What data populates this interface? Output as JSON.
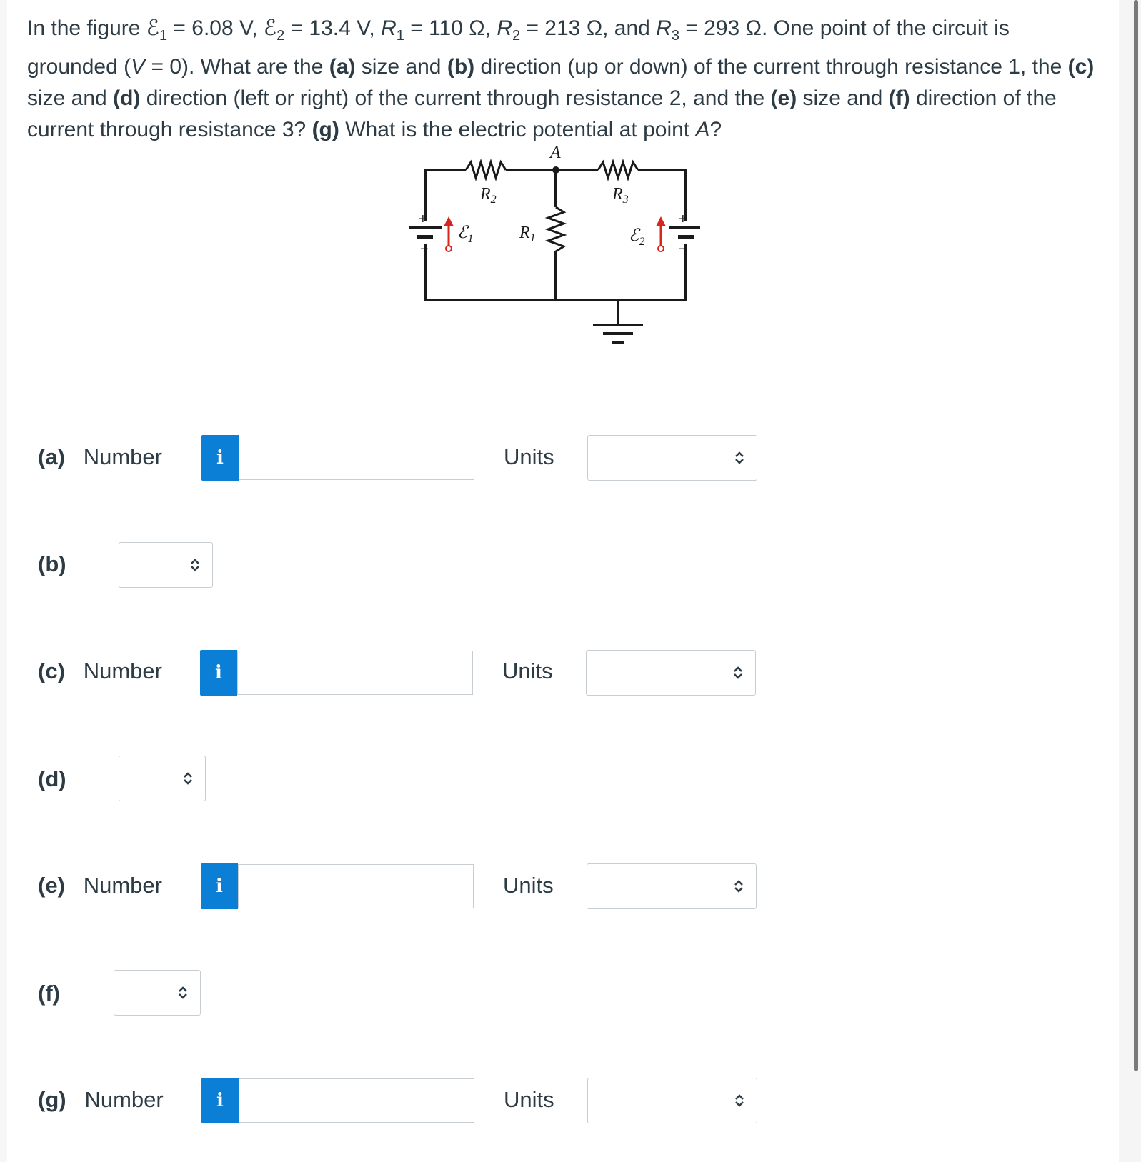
{
  "question": {
    "intro": "In the figure",
    "e1_sym": "ℰ",
    "e1_sub": "1",
    "e1_val": " = 6.08 V, ",
    "e2_sym": "ℰ",
    "e2_sub": "2",
    "e2_val": " = 13.4 V, ",
    "r1_sym": "R",
    "r1_sub": "1",
    "r1_val": " = 110 Ω, ",
    "r2_sym": "R",
    "r2_sub": "2",
    "r2_val": " = 213 Ω, and ",
    "r3_sym": "R",
    "r3_sub": "3",
    "r3_val": " = 293 Ω. One point of the circuit is grounded (",
    "v_sym": "V",
    "v_val": " = 0). What are the ",
    "a_tag": "(a)",
    "t1": " size and ",
    "b_tag": "(b)",
    "t2": " direction (up or down) of the current through resistance 1, the ",
    "c_tag": "(c)",
    "t3": " size and ",
    "d_tag": "(d)",
    "t4": " direction (left or right) of the current through resistance 2, and the ",
    "e_tag": "(e)",
    "t5": " size and ",
    "f_tag": "(f)",
    "t6": " direction of the current through resistance 3? ",
    "g_tag": "(g)",
    "t7": " What is the electric potential at point ",
    "point": "A",
    "end": "?"
  },
  "figure": {
    "point_label": "A",
    "r1": "R",
    "r1_sub": "1",
    "r2": "R",
    "r2_sub": "2",
    "r3": "R",
    "r3_sub": "3",
    "e1": "ℰ",
    "e1_sub": "1",
    "e2": "ℰ",
    "e2_sub": "2",
    "plus": "+",
    "minus": "−"
  },
  "answers": {
    "number_label": "Number",
    "units_label": "Units",
    "info_glyph": "i",
    "parts": {
      "a": "(a)",
      "b": "(b)",
      "c": "(c)",
      "d": "(d)",
      "e": "(e)",
      "f": "(f)",
      "g": "(g)"
    }
  },
  "icons": {
    "info": "info-icon",
    "select": "chevron-updown-icon"
  },
  "colors": {
    "info_button": "#0b7fd6",
    "arrow_red": "#d7261e",
    "text": "#2d3b45"
  }
}
